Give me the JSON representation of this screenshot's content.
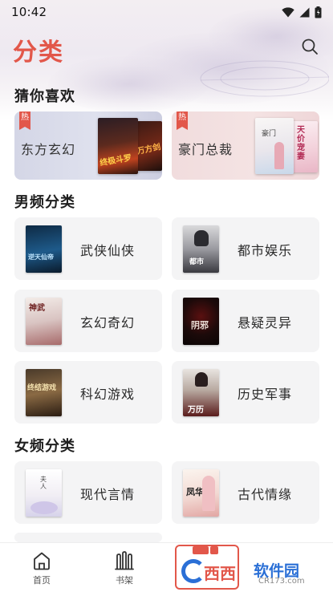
{
  "status_bar": {
    "time": "10:42"
  },
  "header": {
    "title": "分类"
  },
  "sections": {
    "guess": {
      "title": "猜你喜欢",
      "hot_badge": "热",
      "cards": [
        {
          "label": "东方玄幻",
          "cover_titles": [
            "终极斗罗",
            "万方剑"
          ]
        },
        {
          "label": "豪门总裁",
          "cover_titles": [
            "豪门",
            "天价宠妻"
          ]
        }
      ]
    },
    "male": {
      "title": "男频分类",
      "items": [
        {
          "label": "武侠仙侠",
          "cover_text": "逆天仙帝"
        },
        {
          "label": "都市娱乐",
          "cover_text": "都市"
        },
        {
          "label": "玄幻奇幻",
          "cover_text": "神武"
        },
        {
          "label": "悬疑灵异",
          "cover_text": "阴邪"
        },
        {
          "label": "科幻游戏",
          "cover_text": "终结游戏"
        },
        {
          "label": "历史军事",
          "cover_text": "万历"
        }
      ]
    },
    "female": {
      "title": "女频分类",
      "items": [
        {
          "label": "现代言情",
          "cover_text": "夫人"
        },
        {
          "label": "古代情缘",
          "cover_text": "凤华"
        }
      ]
    }
  },
  "bottom_nav": [
    {
      "label": "首页",
      "icon": "home-icon"
    },
    {
      "label": "书架",
      "icon": "bookshelf-icon"
    }
  ],
  "watermark": {
    "text": "西西",
    "text2": "软件园",
    "sub": "CR173.com"
  },
  "colors": {
    "accent": "#e2574a",
    "card_bg": "#f4f4f5"
  }
}
